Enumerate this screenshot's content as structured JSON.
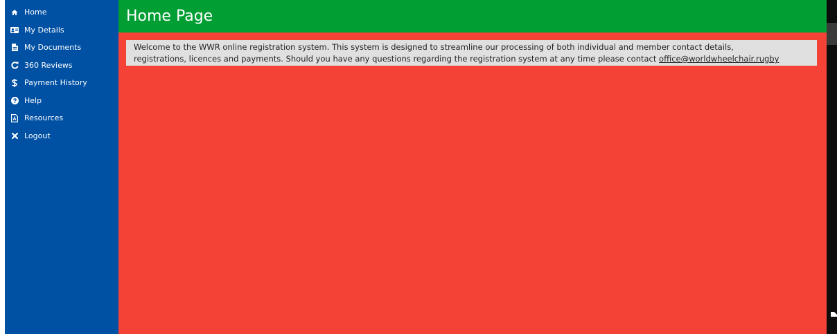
{
  "sidebar": {
    "items": [
      {
        "label": "Home",
        "icon": "home-icon"
      },
      {
        "label": "My Details",
        "icon": "id-card-icon"
      },
      {
        "label": "My Documents",
        "icon": "document-icon"
      },
      {
        "label": "360 Reviews",
        "icon": "refresh-icon"
      },
      {
        "label": "Payment History",
        "icon": "dollar-icon"
      },
      {
        "label": "Help",
        "icon": "question-icon"
      },
      {
        "label": "Resources",
        "icon": "pdf-icon"
      },
      {
        "label": "Logout",
        "icon": "close-icon"
      }
    ]
  },
  "header": {
    "title": "Home Page"
  },
  "welcome": {
    "line1": "Welcome to the WWR online registration system.  This system is designed to streamline our processing of both individual and member contact details,",
    "line2": "registrations, licences and payments.  Should you have any questions regarding the registration system at any time please contact ",
    "email": "office@worldwheelchair.rugby"
  },
  "colors": {
    "sidebar": "#0050a4",
    "header": "#009e33",
    "content": "#f44336",
    "welcome_box": "#e0e0e0"
  }
}
